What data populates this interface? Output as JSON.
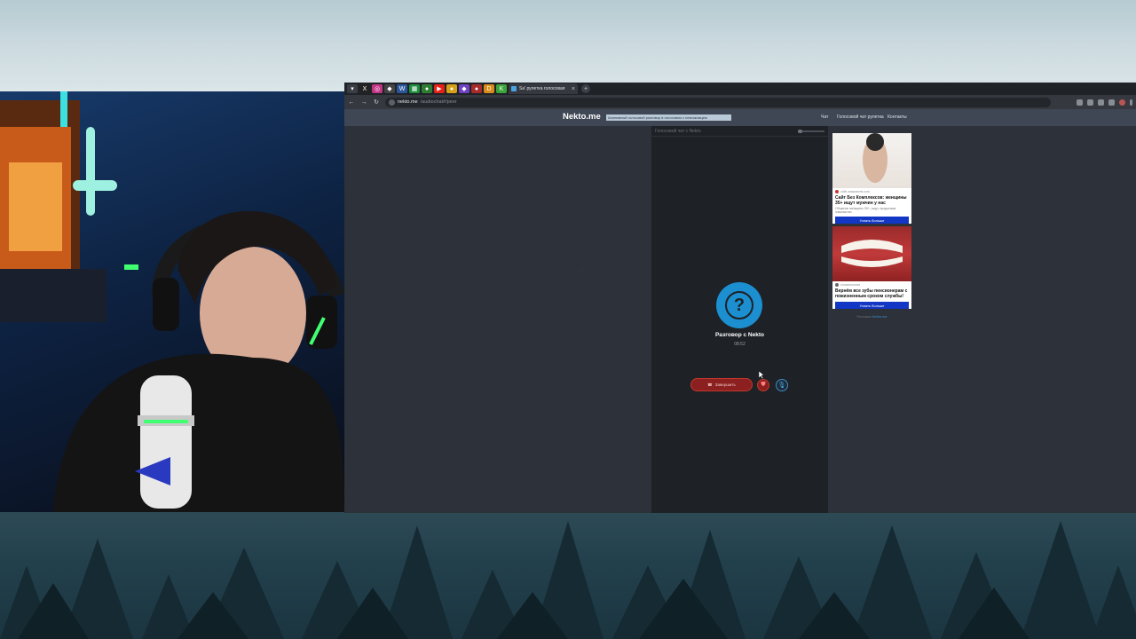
{
  "browser": {
    "active_tab_title": "Sa' рулетка голосовая",
    "url_host": "nekto.me",
    "url_path": "/audiochat#/peer",
    "tab_count_icons": 12
  },
  "site": {
    "logo": "Nekto.me",
    "banner_text": "Анонимный голосовой разговор в голосовом с незнакомцем",
    "nav": {
      "chat": "Чат",
      "voice_chat": "Голосовой чат рулетка",
      "contacts": "Контакты"
    }
  },
  "chat": {
    "header": "Голосовой чат с Nekto",
    "title": "Разговор с Nekto",
    "timer": "08:52",
    "end_button": "Завершить",
    "avatar_mark": "?"
  },
  "ads": [
    {
      "source": "сайт-знакомств.com",
      "title": "Сайт Без Комплексов: женщины 35+ ищут мужчин у нас",
      "description": "Общение женщины 35+, ищут, продолжая знакомство",
      "button": "Узнать больше"
    },
    {
      "source": "стоматология",
      "title": "Вернём все зубы пенсионерам с пожизненным сроком службы!",
      "description": "",
      "button": "Узнать больше"
    }
  ],
  "ads_footer": {
    "text": "Реклама",
    "link": "Nekto.me"
  },
  "colors": {
    "accent": "#1b8fd0",
    "danger": "#8c1f1f",
    "header": "#3f4755",
    "panel": "#1e2126",
    "ad_button": "#1237c4"
  },
  "icons": {
    "back": "arrow-left-icon",
    "forward": "arrow-right-icon",
    "reload": "reload-icon",
    "phone": "phone-hangup-icon",
    "report": "shield-icon",
    "mic": "microphone-icon"
  }
}
